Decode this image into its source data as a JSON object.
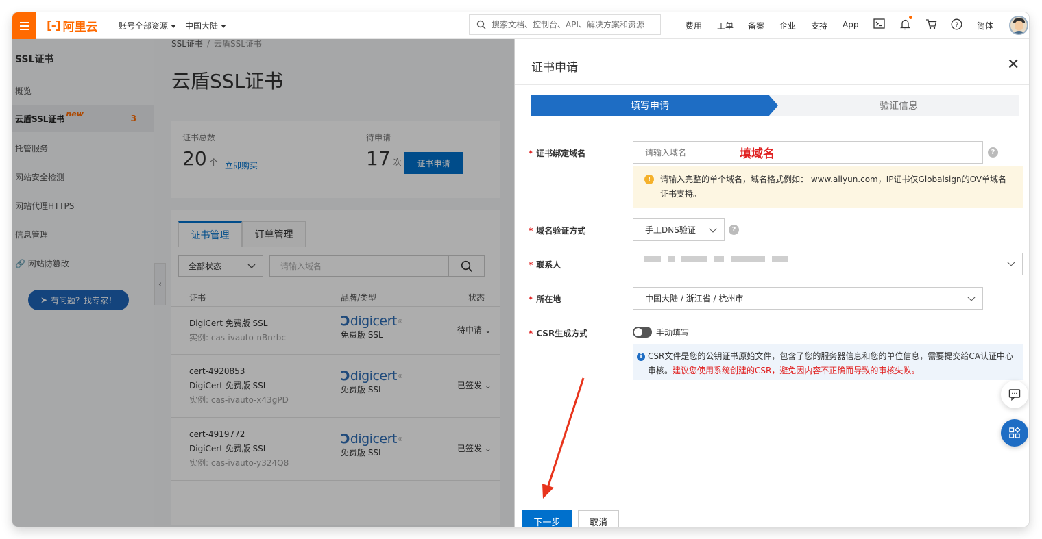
{
  "topbar": {
    "logo_text": "阿里云",
    "account_label": "账号全部资源",
    "region_label": "中国大陆",
    "search_placeholder": "搜索文档、控制台、API、解决方案和资源",
    "nav_items": [
      "费用",
      "工单",
      "备案",
      "企业",
      "支持",
      "App"
    ],
    "language": "简体"
  },
  "sidebar": {
    "title": "SSL证书",
    "items": [
      {
        "label": "概览"
      },
      {
        "label": "云盾SSL证书",
        "badge": "new",
        "count": "3"
      },
      {
        "label": "托管服务"
      },
      {
        "label": "网站安全检测"
      },
      {
        "label": "网站代理HTTPS"
      },
      {
        "label": "信息管理"
      },
      {
        "label": "网站防篡改"
      }
    ],
    "expert_button": "有问题？找专家！"
  },
  "main": {
    "breadcrumb": [
      "SSL证书",
      "云盾SSL证书"
    ],
    "page_title": "云盾SSL证书",
    "stats": {
      "total_label": "证书总数",
      "total_value": "20",
      "total_unit": "个",
      "buy_link": "立即购买",
      "pending_label": "待申请",
      "pending_value": "17",
      "pending_unit": "次",
      "apply_button": "证书申请"
    },
    "tabs": [
      "证书管理",
      "订单管理"
    ],
    "filter": {
      "status_value": "全部状态",
      "domain_placeholder": "请输入域名"
    },
    "table": {
      "headers": [
        "证书",
        "品牌/类型",
        "状态"
      ],
      "rows": [
        {
          "name": "",
          "product": "DigiCert 免费版 SSL",
          "instance": "实例: cas-ivauto-nBnrbc",
          "brand": "digicert",
          "type": "免费版 SSL",
          "status": "待申请"
        },
        {
          "name": "cert-4920853",
          "product": "DigiCert 免费版 SSL",
          "instance": "实例: cas-ivauto-x43gPD",
          "brand": "digicert",
          "type": "免费版 SSL",
          "status": "已签发"
        },
        {
          "name": "cert-4919772",
          "product": "DigiCert 免费版 SSL",
          "instance": "实例: cas-ivauto-y324Q8",
          "brand": "digicert",
          "type": "免费版 SSL",
          "status": "已签发"
        }
      ]
    }
  },
  "drawer": {
    "title": "证书申请",
    "steps": [
      "填写申请",
      "验证信息"
    ],
    "fields": {
      "domain": {
        "label": "证书绑定域名",
        "placeholder": "请输入域名",
        "annotation": "填域名"
      },
      "domain_hint": "请输入完整的单个域名，域名格式例如： www.aliyun.com，IP证书仅Globalsign的OV单域名证书支持。",
      "verify": {
        "label": "域名验证方式",
        "value": "手工DNS验证"
      },
      "contact": {
        "label": "联系人"
      },
      "location": {
        "label": "所在地",
        "value": "中国大陆 / 浙江省 / 杭州市"
      },
      "csr": {
        "label": "CSR生成方式",
        "toggle_label": "手动填写"
      },
      "csr_info": "CSR文件是您的公钥证书原始文件，包含了您的服务器信息和您的单位信息，需要提交给CA认证中心审核。",
      "csr_warning": "建议您使用系统创建的CSR，避免因内容不正确而导致的审核失败。"
    },
    "buttons": {
      "next": "下一步",
      "cancel": "取消"
    }
  },
  "colors": {
    "brand_orange": "#ff6a00",
    "primary_blue": "#0070cc",
    "annotation_red": "#e02020"
  }
}
